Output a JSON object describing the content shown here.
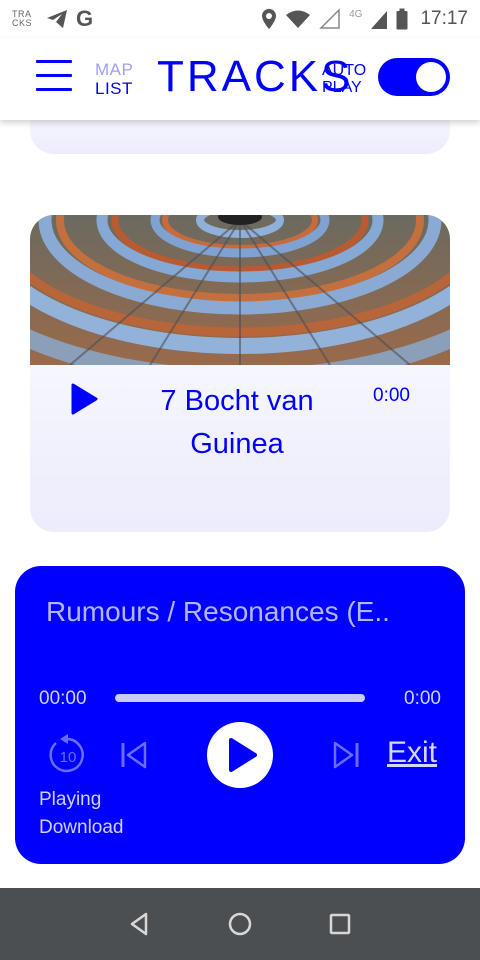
{
  "status_bar": {
    "app_mini_label_line1": "TRA",
    "app_mini_label_line2": "CKS",
    "google_glyph": "G",
    "network_type": "4G",
    "time": "17:17",
    "icons": [
      "telegram-icon",
      "location-icon",
      "wifi-icon",
      "signal-icon",
      "battery-icon"
    ]
  },
  "header": {
    "view_map_label": "MAP",
    "view_list_label": "LIST",
    "title": "TRACKS",
    "autoplay_line1": "AUTO",
    "autoplay_line2": "PLAY",
    "autoplay_enabled": true,
    "icons": [
      "hamburger-menu-icon"
    ]
  },
  "track_card": {
    "title": "7 Bocht van Guinea",
    "time": "0:00",
    "image": "circular-parliament-chamber-photo",
    "icons": [
      "play-icon"
    ]
  },
  "player": {
    "title": "Rumours / Resonances (E..",
    "elapsed": "00:00",
    "total": "0:00",
    "progress": 0,
    "exit_label": "Exit",
    "status_line1": "Playing",
    "status_line2": "Download",
    "rewind_seconds": "10",
    "icons": [
      "rewind-10-icon",
      "skip-previous-icon",
      "play-icon",
      "skip-next-icon"
    ]
  },
  "nav_bar": {
    "icons": [
      "back-icon",
      "home-icon",
      "recents-icon"
    ]
  },
  "colors": {
    "accent": "#0000ff",
    "card_tint": "#ececfc",
    "nav_bg": "#4b4f52"
  }
}
